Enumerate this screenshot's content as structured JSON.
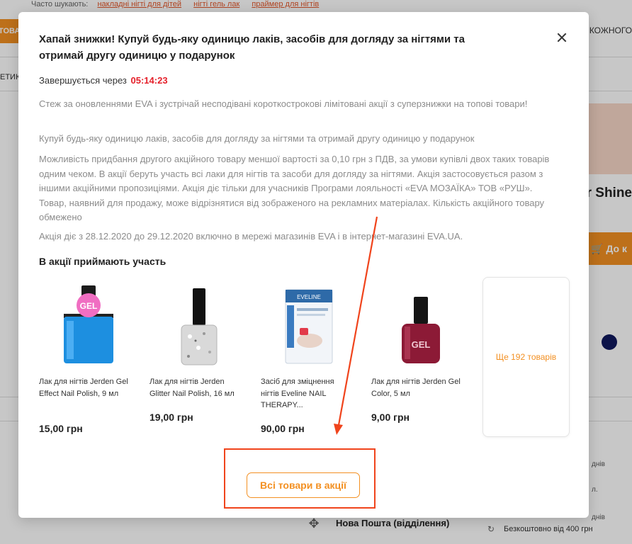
{
  "background": {
    "hints_label": "Часто шукають:",
    "hints": [
      "накладні нігті для дітей",
      "нігті гель лак",
      "праймер для нігтів"
    ],
    "nav_button": "ТОВАР",
    "side_text": "ЕТИКА",
    "right_nav": "А КОЖНОГО",
    "product_title": "r Shine",
    "cart_button": "До к",
    "side_snippets": [
      "днів",
      "л.",
      "днів"
    ],
    "delivery_name": "Нова Пошта (відділення)",
    "delivery_free": "Безкоштовно від 400 грн",
    "colors": {
      "accent": "#f39022",
      "dot": "#10195e"
    }
  },
  "modal": {
    "title": "Хапай знижки! Купуй будь-яку одиницю лаків, засобів для догляду за нігтями та отримай другу одиницю у подарунок",
    "timer_label": "Завершується через",
    "timer_value": "05:14:23",
    "paragraphs": [
      "Стеж за оновленнями EVA і зустрічай несподівані короткострокові лімітовані акції з суперзнижки на топові товари!",
      "Купуй будь-яку одиницю лаків, засобів для догляду за нігтями та отримай другу одиницю у подарунок",
      "Можливість придбання другого акційного товару меншої вартості за 0,10 грн з ПДВ, за умови купівлі двох таких товарів одним чеком. В акції беруть участь всі лаки для нігтів та засоби для догляду за нігтями. Акція застосовується разом з іншими акційними пропозиціями. Акція діє тільки для учасників Програми лояльності «EVA МОЗАЇКА» ТОВ «РУШ». Товар, наявний для продажу, може відрізнятися від зображеного на рекламних матеріалах. Кількість акційного товару обмежено",
      "Акція діє з 28.12.2020 до 29.12.2020 включно в мережі магазинів EVA і в інтернет-магазині EVA.UA."
    ],
    "products_heading": "В акції приймають участь",
    "products": [
      {
        "name": "Лак для нігтів Jerden Gel Effect Nail Polish, 9 мл",
        "price": "15,00 грн",
        "label": "GEL"
      },
      {
        "name": "Лак для нігтів Jerden Glitter Nail Polish, 16 мл",
        "price": "19,00 грн",
        "label": ""
      },
      {
        "name": "Засіб для зміцнення нігтів Eveline NAIL THERAPY...",
        "price": "90,00 грн",
        "label": "EVELINE"
      },
      {
        "name": "Лак для нігтів Jerden Gel Color, 5 мл",
        "price": "9,00 грн",
        "label": "GEL"
      }
    ],
    "more_label": "Ще 192 товарів",
    "all_button": "Всі товари в акції",
    "colors": {
      "timer": "#e5202a",
      "accent": "#f39022",
      "annotation": "#f0441c"
    }
  }
}
